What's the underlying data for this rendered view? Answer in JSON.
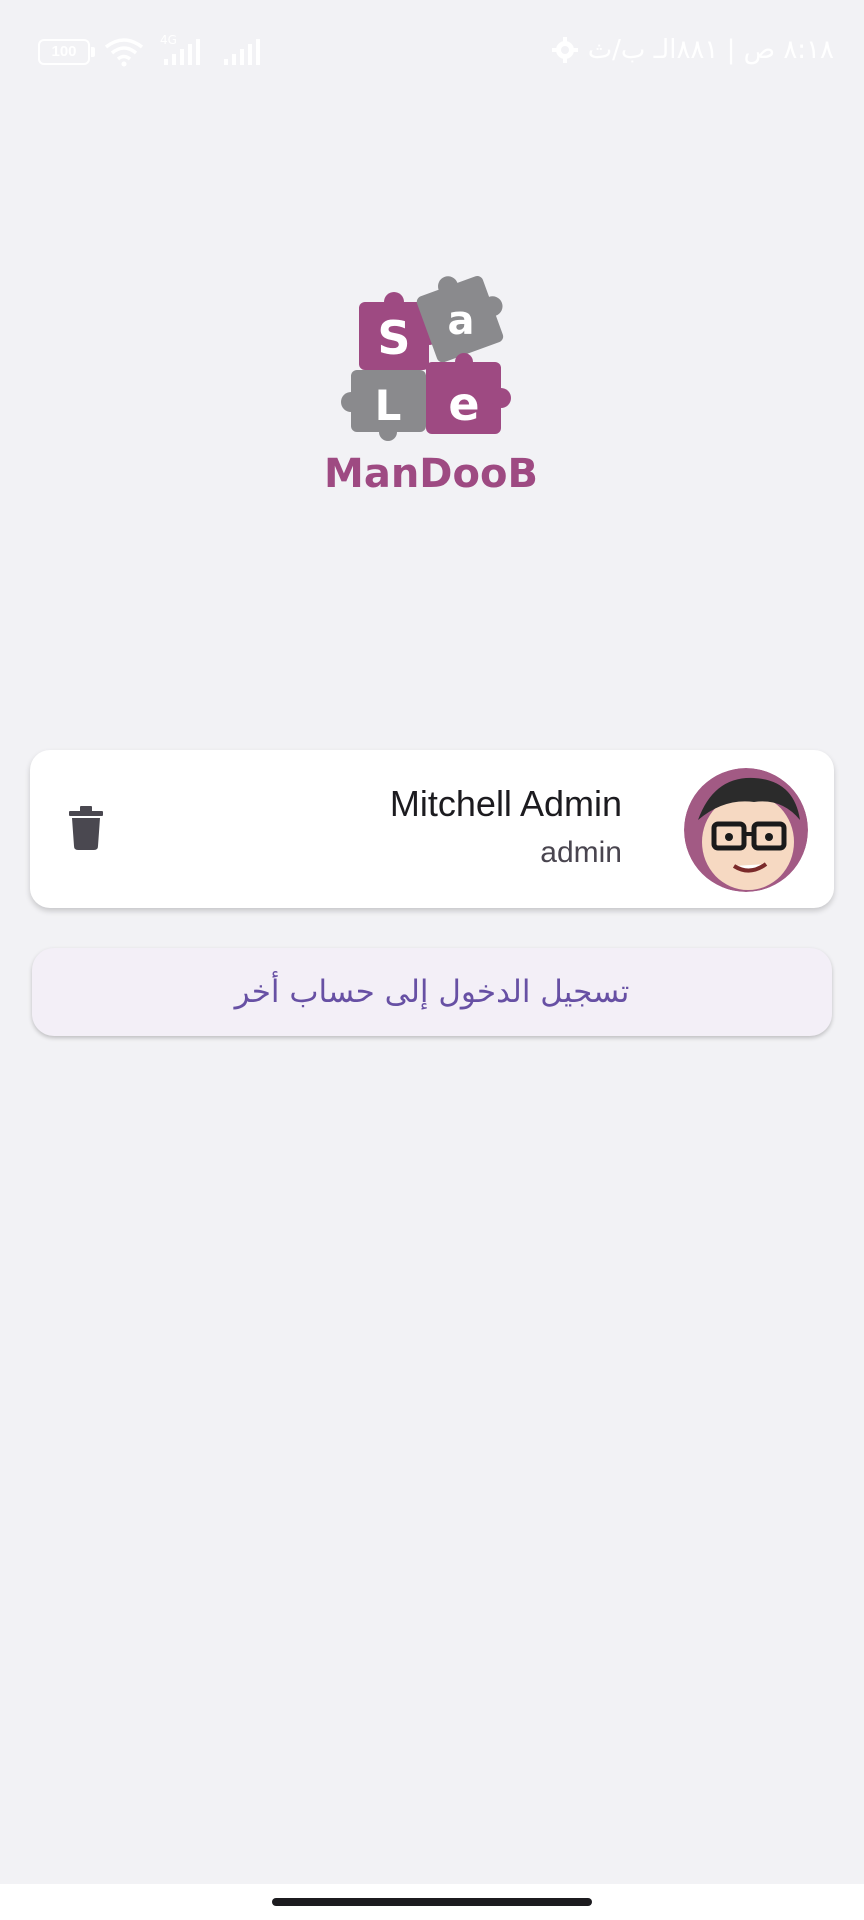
{
  "status_bar": {
    "time_text": "٨:١٨ ص | ٨٨١الـ ب/ث",
    "battery_level": "100",
    "network_label": "4G",
    "icons": [
      "battery-icon",
      "wifi-icon",
      "signal-icon",
      "settings-icon"
    ]
  },
  "logo": {
    "wordmark": "ManDooB",
    "puzzle_letters": [
      "S",
      "a",
      "L",
      "e"
    ],
    "colors": {
      "magenta": "#9e4a82",
      "gray": "#8a8a8d"
    }
  },
  "account": {
    "name": "Mitchell Admin",
    "login": "admin",
    "delete_icon": "trash-icon",
    "avatar_icon": "avatar-cartoon"
  },
  "actions": {
    "login_other_account": "تسجيل الدخول إلى حساب أخر"
  },
  "theme": {
    "background": "#f2f2f5",
    "accent": "#6750a4",
    "button_bg": "#f3eff7"
  }
}
